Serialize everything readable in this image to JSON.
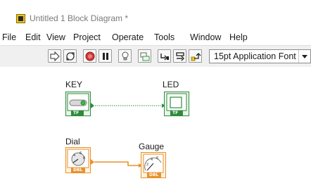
{
  "window": {
    "title": "Untitled 1 Block Diagram *",
    "icon": "labview-app-icon"
  },
  "menu": {
    "items": [
      "File",
      "Edit",
      "View",
      "Project",
      "Operate",
      "Tools",
      "Window",
      "Help"
    ]
  },
  "toolbar": {
    "buttons": [
      {
        "name": "run-arrow-icon"
      },
      {
        "name": "run-continuously-icon"
      },
      {
        "name": "abort-execution-icon"
      },
      {
        "name": "pause-icon"
      },
      {
        "name": "highlight-execution-icon"
      },
      {
        "name": "retain-wire-values-icon"
      },
      {
        "name": "step-into-icon"
      },
      {
        "name": "step-over-icon"
      },
      {
        "name": "step-out-icon"
      }
    ],
    "font_selector": {
      "value": "15pt Application Font"
    }
  },
  "diagram": {
    "nodes": [
      {
        "label": "KEY",
        "type": "boolean-control",
        "terminal_text": "TF"
      },
      {
        "label": "LED",
        "type": "boolean-indicator",
        "terminal_text": "TF"
      },
      {
        "label": "Dial",
        "type": "numeric-control",
        "terminal_text": "DBL"
      },
      {
        "label": "Gauge",
        "type": "numeric-indicator",
        "terminal_text": "DBL"
      }
    ],
    "colors": {
      "boolean": "#2e8b3c",
      "numeric": "#e8912b"
    }
  }
}
